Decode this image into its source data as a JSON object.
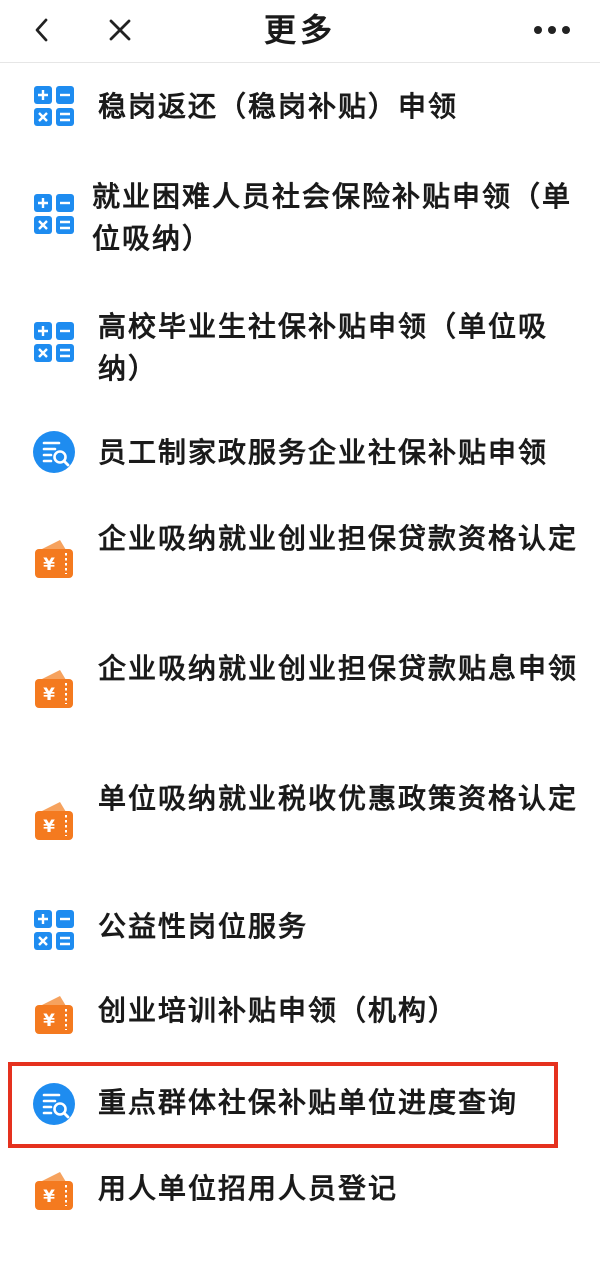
{
  "header": {
    "title": "更多",
    "back_icon": "chevron-left-icon",
    "close_icon": "close-icon",
    "more_icon": "more-dots-icon"
  },
  "colors": {
    "calc_blue": "#1e8cf0",
    "search_blue": "#1e8cf0",
    "wallet_orange": "#f47a1f",
    "highlight_red": "#e5311e"
  },
  "items": [
    {
      "label": "稳岗返还（稳岗补贴）申领",
      "icon": "calculator-icon"
    },
    {
      "label": "就业困难人员社会保险补贴申领（单位吸纳）",
      "icon": "calculator-icon"
    },
    {
      "label": "高校毕业生社保补贴申领（单位吸纳）",
      "icon": "calculator-icon"
    },
    {
      "label": "员工制家政服务企业社保补贴申领",
      "icon": "search-document-icon"
    },
    {
      "label": "企业吸纳就业创业担保贷款资格认定",
      "icon": "wallet-yuan-icon"
    },
    {
      "label": "企业吸纳就业创业担保贷款贴息申领",
      "icon": "wallet-yuan-icon"
    },
    {
      "label": "单位吸纳就业税收优惠政策资格认定",
      "icon": "wallet-yuan-icon"
    },
    {
      "label": "公益性岗位服务",
      "icon": "calculator-icon"
    },
    {
      "label": "创业培训补贴申领（机构）",
      "icon": "wallet-yuan-icon"
    },
    {
      "label": "重点群体社保补贴单位进度查询",
      "icon": "search-document-icon"
    },
    {
      "label": "用人单位招用人员登记",
      "icon": "wallet-yuan-icon"
    }
  ]
}
